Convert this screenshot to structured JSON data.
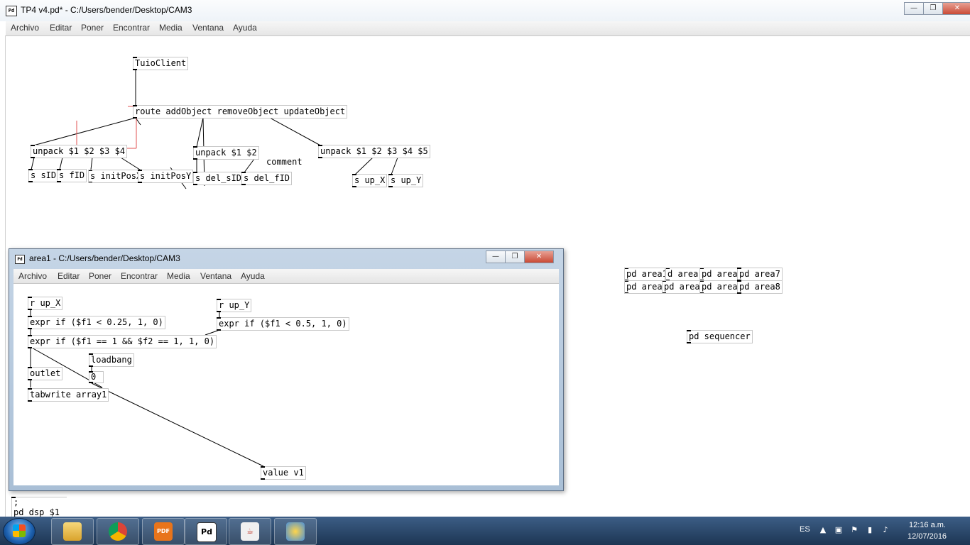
{
  "window": {
    "title": "TP4 v4.pd* - C:/Users/bender/Desktop/CAM3",
    "logo": "Pd",
    "buttons": {
      "minimize": "—",
      "maximize": "❐",
      "close": "✕"
    }
  },
  "menu": [
    "Archivo",
    "Editar",
    "Poner",
    "Encontrar",
    "Media",
    "Ventana",
    "Ayuda"
  ],
  "main_patch": {
    "objects": {
      "tuioclient": "TuioClient",
      "route": "route addObject removeObject updateObject",
      "unpack4": "unpack $1 $2 $3 $4",
      "unpack2": "unpack $1 $2",
      "unpack5": "unpack $1 $2 $3 $4 $5",
      "s_sid": "s sID",
      "s_fid": "s fID",
      "s_initposx": "s initPosX",
      "s_initposy": "s initPosY",
      "s_delsid": "s del_sID",
      "s_delfid": "s del_fID",
      "s_upx": "s up_X",
      "s_upy": "s up_Y",
      "comment": "comment",
      "pd_area1": "pd area1",
      "pd_area_b": "d area",
      "pd_area_c": "pd area",
      "pd_area7": "pd area7",
      "pd_area_e": "pd area",
      "pd_area_f": "pd area",
      "pd_area_g": "pd area",
      "pd_area8": "pd area8",
      "pd_sequencer": "pd sequencer",
      "dsp_msg_1": ";",
      "dsp_msg_2": "pd dsp $1"
    }
  },
  "subwindow": {
    "title": "area1  - C:/Users/bender/Desktop/CAM3",
    "objects": {
      "r_upx": "r up_X",
      "r_upy": "r up_Y",
      "expr1": "expr if ($f1 < 0.25, 1, 0)",
      "expr2": "expr if ($f1 < 0.5, 1, 0)",
      "expr3": "expr if ($f1 == 1 && $f2 == 1, 1, 0)",
      "loadbang": "loadbang",
      "outlet": "outlet",
      "msg0": "0",
      "tabwrite": "tabwrite array1",
      "value": "value v1"
    }
  },
  "taskbar": {
    "apps": [
      "file-explorer",
      "chrome",
      "pdf-reader",
      "pure-data",
      "java",
      "paint"
    ],
    "pd_label": "Pd",
    "pdf_label": "PDF",
    "lang": "ES",
    "time": "12:16 a.m.",
    "date": "12/07/2016"
  }
}
